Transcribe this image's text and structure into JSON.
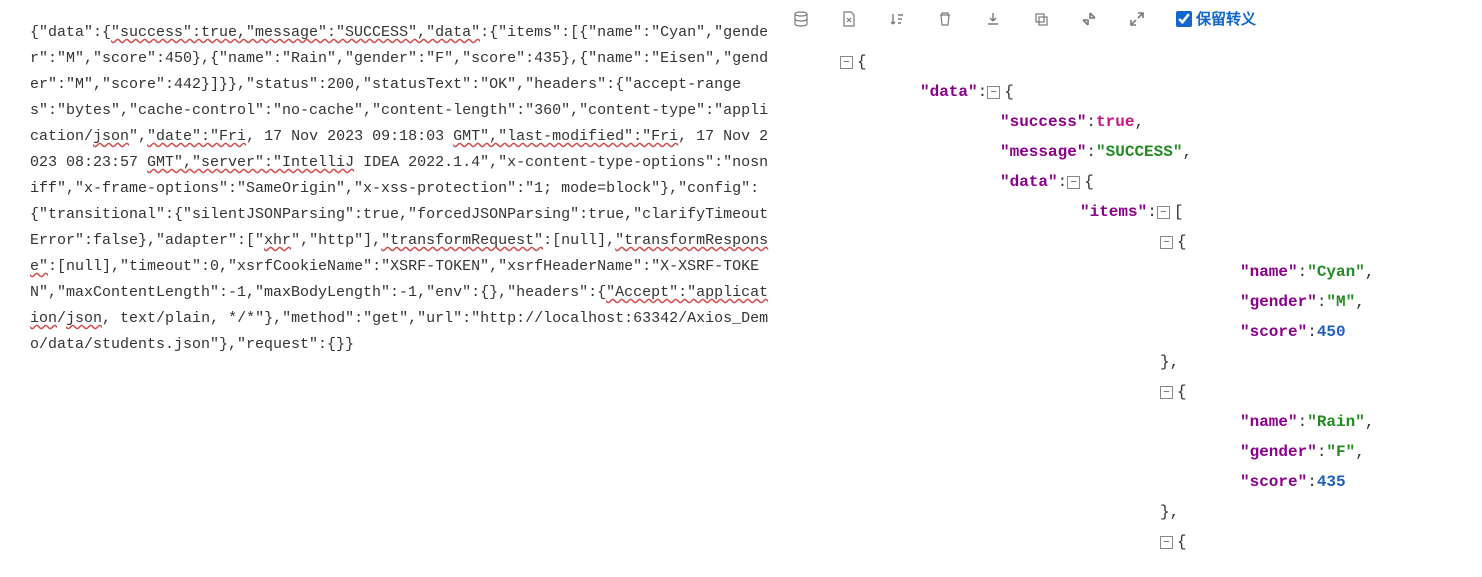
{
  "leftPane": {
    "raw": "{\"data\":{\"success\":true,\"message\":\"SUCCESS\",\"data\":{\"items\":[{\"name\":\"Cyan\",\"gender\":\"M\",\"score\":450},{\"name\":\"Rain\",\"gender\":\"F\",\"score\":435},{\"name\":\"Eisen\",\"gender\":\"M\",\"score\":442}]}},\"status\":200,\"statusText\":\"OK\",\"headers\":{\"accept-ranges\":\"bytes\",\"cache-control\":\"no-cache\",\"content-length\":\"360\",\"content-type\":\"application/json\",\"date\":\"Fri, 17 Nov 2023 09:18:03 GMT\",\"last-modified\":\"Fri, 17 Nov 2023 08:23:57 GMT\",\"server\":\"IntelliJ IDEA 2022.1.4\",\"x-content-type-options\":\"nosniff\",\"x-frame-options\":\"SameOrigin\",\"x-xss-protection\":\"1; mode=block\"},\"config\":{\"transitional\":{\"silentJSONParsing\":true,\"forcedJSONParsing\":true,\"clarifyTimeoutError\":false},\"adapter\":[\"xhr\",\"http\"],\"transformRequest\":[null],\"transformResponse\":[null],\"timeout\":0,\"xsrfCookieName\":\"XSRF-TOKEN\",\"xsrfHeaderName\":\"X-XSRF-TOKEN\",\"maxContentLength\":-1,\"maxBodyLength\":-1,\"env\":{},\"headers\":{\"Accept\":\"application/json, text/plain, */*\"},\"method\":\"get\",\"url\":\"http://localhost:63342/Axios_Demo/data/students.json\"},\"request\":{}}",
    "segments": {
      "p1a": "{\"data\":{",
      "p1b": "\"success\":true,\"message\":\"SUCCESS\",\"data\"",
      "p1c": ":{\"items\":[{\"name\":\"Cyan\",\"gender\":\"M\",\"score\":450},{\"name\":\"Rain\",\"gender\":\"F\",\"score\":435},{\"name\":\"Eisen\",\"gender\":\"M\",\"score\":442}]}},\"status\":200,\"statusText\":\"OK\",\"headers\":{\"accept-ranges\":\"bytes\",\"cache-control\":\"no-cache\",\"content-length\":\"360\",\"content-type\":\"application/",
      "p1d": "json",
      "p1e": "\",",
      "p2a": "\"date\":\"Fri",
      "p2b": ", 17 Nov 2023 09:18:03 ",
      "p2c": "GMT\",\"last-modified\":\"Fri",
      "p2d": ", 17 Nov 2023 08:23:57 ",
      "p2e": "GMT\",\"server\":\"IntelliJ",
      "p2f": " IDEA 2022.1.4\",\"x-content-type-options\":\"nosniff\",\"x-frame-options\":\"SameOrigin\",\"x-xss-protection\":\"1; mode=block\"},\"config\":{\"transitional\":{\"silentJSONParsing\":true,\"forcedJSONParsing\":true,\"clarifyTimeoutError\":false},\"adapter\":[\"",
      "p3a": "xhr",
      "p3b": "\",\"http\"],",
      "p3c": "\"transformRequest\"",
      "p3d": ":[null],",
      "p3e": "\"transformResponse\"",
      "p3f": ":[null],\"timeout\":0,\"xsrfCookieName\":\"XSRF-TOKEN\",\"xsrfHeaderName\":\"X-XSRF-TOKEN\",\"maxContentLength\":-1,\"maxBodyLength\":-1,\"env\":{},\"headers\":{",
      "p4a": "\"Accept\":\"application",
      "p4b": "/",
      "p4c": "json",
      "p4d": ", text/plain, */*\"},\"method\":\"get\",\"url\":\"http://localhost:63342/Axios_Demo/data/students.json\"},\"request\":{}}"
    }
  },
  "toolbar": {
    "escape_label": "保留转义"
  },
  "tree": {
    "data": {
      "key": "\"data\"",
      "success": {
        "key": "\"success\"",
        "value": "true"
      },
      "message": {
        "key": "\"message\"",
        "value": "\"SUCCESS\""
      },
      "innerData": {
        "key": "\"data\"",
        "items": {
          "key": "\"items\"",
          "list": [
            {
              "name": {
                "key": "\"name\"",
                "value": "\"Cyan\""
              },
              "gender": {
                "key": "\"gender\"",
                "value": "\"M\""
              },
              "score": {
                "key": "\"score\"",
                "value": "450"
              }
            },
            {
              "name": {
                "key": "\"name\"",
                "value": "\"Rain\""
              },
              "gender": {
                "key": "\"gender\"",
                "value": "\"F\""
              },
              "score": {
                "key": "\"score\"",
                "value": "435"
              }
            }
          ]
        }
      }
    }
  }
}
